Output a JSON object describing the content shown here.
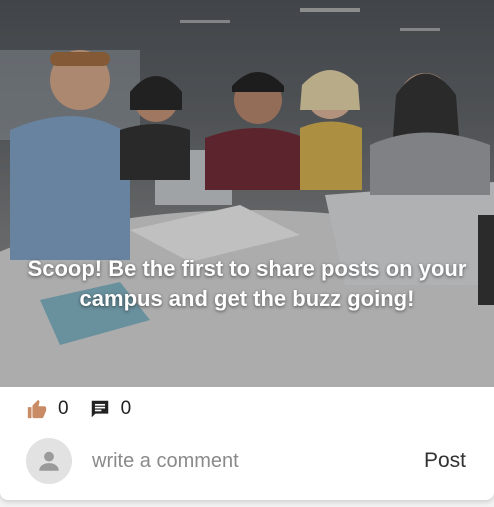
{
  "post": {
    "image_alt": "Students studying around a table",
    "headline": "Scoop! Be the first to share posts on your campus and get the buzz going!",
    "likes": "0",
    "comments": "0"
  },
  "icons": {
    "like": "thumbs-up-icon",
    "comment": "comment-icon",
    "avatar": "person-icon"
  },
  "comment_box": {
    "placeholder": "write a comment",
    "post_label": "Post"
  },
  "colors": {
    "like_icon": "#c98b65",
    "comment_icon": "#222222",
    "avatar_bg": "#e2e2e2",
    "avatar_fg": "#9a9a9a"
  }
}
